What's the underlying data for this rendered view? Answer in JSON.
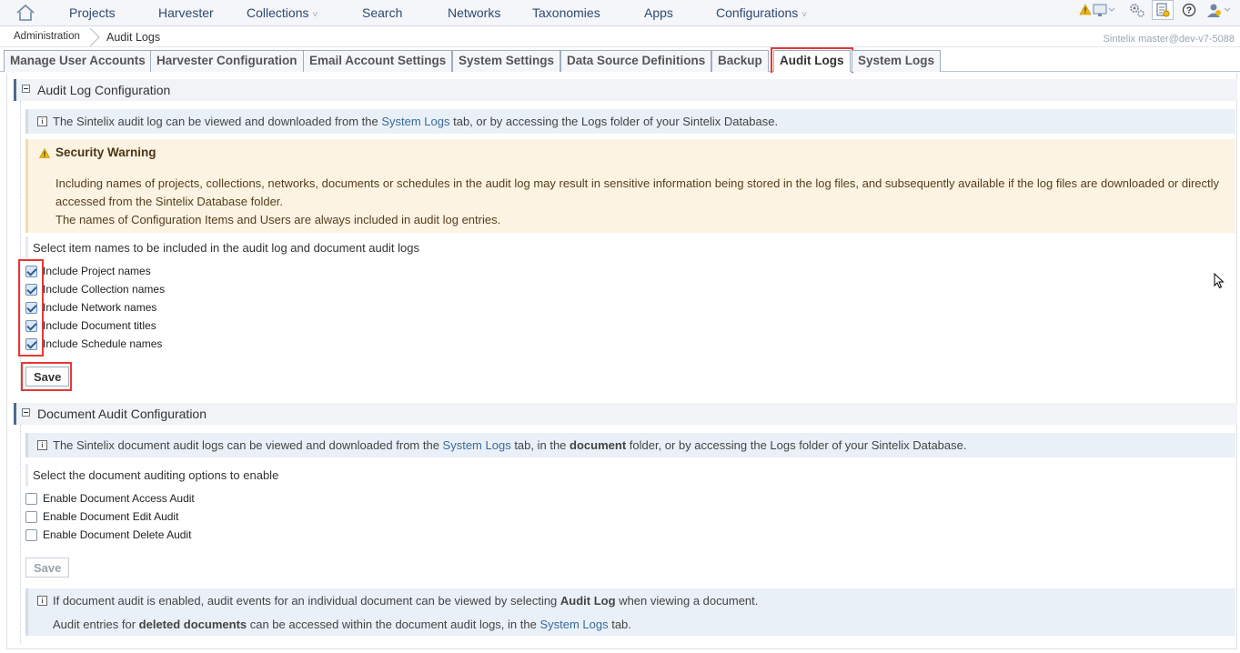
{
  "nav": {
    "items": [
      {
        "label": "Projects",
        "dropdown": false
      },
      {
        "label": "Harvester",
        "dropdown": false
      },
      {
        "label": "Collections",
        "dropdown": true
      },
      {
        "label": "Search",
        "dropdown": false
      },
      {
        "label": "Networks",
        "dropdown": false
      },
      {
        "label": "Taxonomies",
        "dropdown": false
      },
      {
        "label": "Apps",
        "dropdown": false
      },
      {
        "label": "Configurations",
        "dropdown": true
      }
    ],
    "right_icons": [
      "warning-monitor-icon",
      "gears-icon",
      "admin-document-icon",
      "help-icon",
      "user-icon"
    ]
  },
  "breadcrumb": {
    "items": [
      "Administration",
      "Audit Logs"
    ],
    "version": "Sintelix master@dev-v7-5088"
  },
  "tabs": [
    {
      "label": "Manage User Accounts",
      "active": false
    },
    {
      "label": "Harvester Configuration",
      "active": false
    },
    {
      "label": "Email Account Settings",
      "active": false
    },
    {
      "label": "System Settings",
      "active": false
    },
    {
      "label": "Data Source Definitions",
      "active": false
    },
    {
      "label": "Backup",
      "active": false
    },
    {
      "label": "Audit Logs",
      "active": true
    },
    {
      "label": "System Logs",
      "active": false
    }
  ],
  "audit_log": {
    "title": "Audit Log Configuration",
    "info_pre": "The Sintelix audit log can be viewed and downloaded from the ",
    "info_link": "System Logs",
    "info_post": " tab, or by accessing the Logs folder of your Sintelix Database.",
    "warning_title": "Security Warning",
    "warning_line1": "Including names of projects, collections, networks, documents or schedules in the audit log may result in sensitive information being stored in the log files, and subsequently available if the log files are downloaded or directly accessed from the Sintelix Database folder.",
    "warning_line2": "The names of Configuration Items and Users are always included in audit log entries.",
    "prompt": "Select item names to be included in the audit log and document audit logs",
    "options": [
      {
        "label": "Include Project names",
        "checked": true
      },
      {
        "label": "Include Collection names",
        "checked": true
      },
      {
        "label": "Include Network names",
        "checked": true
      },
      {
        "label": "Include Document titles",
        "checked": true
      },
      {
        "label": "Include Schedule names",
        "checked": true
      }
    ],
    "save_label": "Save"
  },
  "doc_audit": {
    "title": "Document Audit Configuration",
    "info_pre": "The Sintelix document audit logs can be viewed and downloaded from the ",
    "info_link": "System Logs",
    "info_mid": " tab, in the ",
    "info_bold": "document",
    "info_post": " folder, or by accessing the Logs folder of your Sintelix Database.",
    "prompt": "Select the document auditing options to enable",
    "options": [
      {
        "label": "Enable Document Access Audit",
        "checked": false
      },
      {
        "label": "Enable Document Edit Audit",
        "checked": false
      },
      {
        "label": "Enable Document Delete Audit",
        "checked": false
      }
    ],
    "save_label": "Save",
    "footer_l1_pre": "If document audit is enabled, audit events for an individual document can be viewed by selecting ",
    "footer_l1_bold": "Audit Log",
    "footer_l1_post": " when viewing a document.",
    "footer_l2_pre": "Audit entries for ",
    "footer_l2_bold": "deleted documents",
    "footer_l2_mid": " can be accessed within the document audit logs, in the ",
    "footer_l2_link": "System Logs",
    "footer_l2_post": " tab."
  },
  "colors": {
    "nav_text": "#2d4a70",
    "highlight": "#e53935",
    "info_bg": "#eaf0f7",
    "warning_bg": "#fcf3e2"
  }
}
